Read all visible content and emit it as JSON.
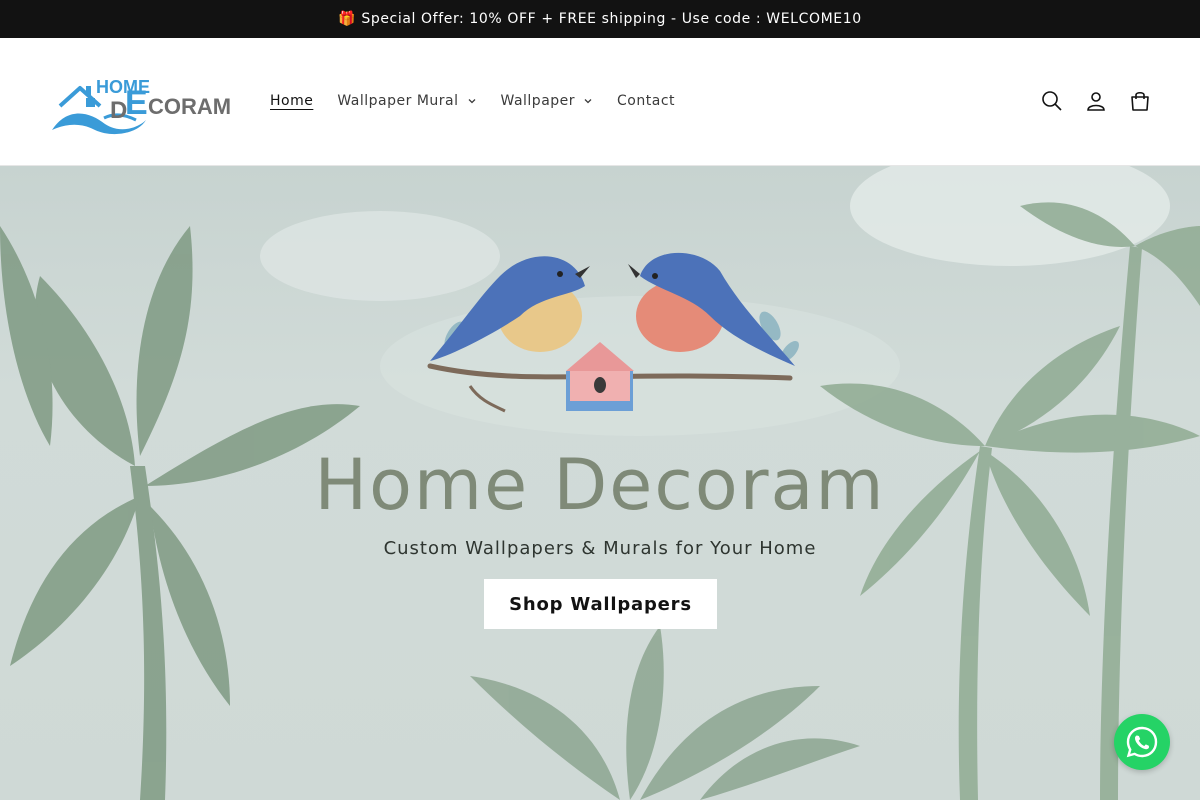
{
  "announcement": {
    "text": "🎁 Special Offer: 10% OFF + FREE shipping - Use code : WELCOME10"
  },
  "logo": {
    "top_text": "HOME",
    "big_letter_d": "D",
    "big_letter_e": "E",
    "rest_text": "CORAM",
    "primary_color": "#3a9bd8",
    "secondary_color": "#6d6d6d"
  },
  "nav": {
    "items": [
      {
        "label": "Home",
        "active": true,
        "has_dropdown": false
      },
      {
        "label": "Wallpaper Mural",
        "active": false,
        "has_dropdown": true
      },
      {
        "label": "Wallpaper",
        "active": false,
        "has_dropdown": true
      },
      {
        "label": "Contact",
        "active": false,
        "has_dropdown": false
      }
    ]
  },
  "header_icons": [
    "search-icon",
    "account-icon",
    "cart-icon"
  ],
  "hero": {
    "title": "Home Decoram",
    "subtitle": "Custom Wallpapers & Murals for Your Home",
    "button_label": "Shop Wallpapers"
  },
  "floating": {
    "whatsapp_icon": "whatsapp-icon",
    "color": "#25d366"
  }
}
